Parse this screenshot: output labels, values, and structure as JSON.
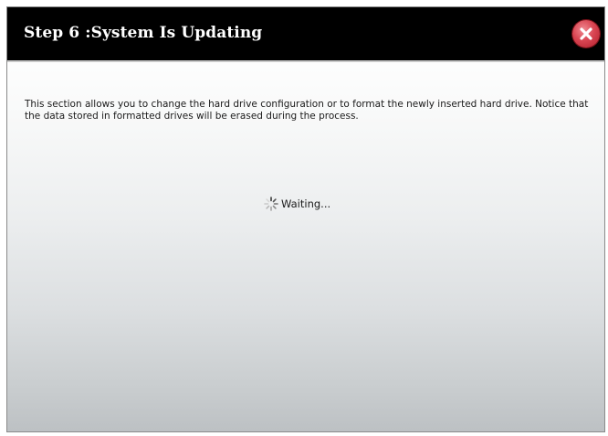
{
  "dialog": {
    "title": "Step 6 :System Is Updating",
    "close_icon": "close-icon",
    "description": "This section allows you to change the hard drive configuration or to format the newly inserted hard drive. Notice that the data stored in formatted drives will be erased during the process.",
    "status": {
      "icon": "spinner-icon",
      "text": "Waiting..."
    }
  },
  "colors": {
    "titlebar_background": "#000000",
    "title_text": "#ffffff",
    "close_button": "#d94552",
    "body_text": "#1a1a1a"
  }
}
